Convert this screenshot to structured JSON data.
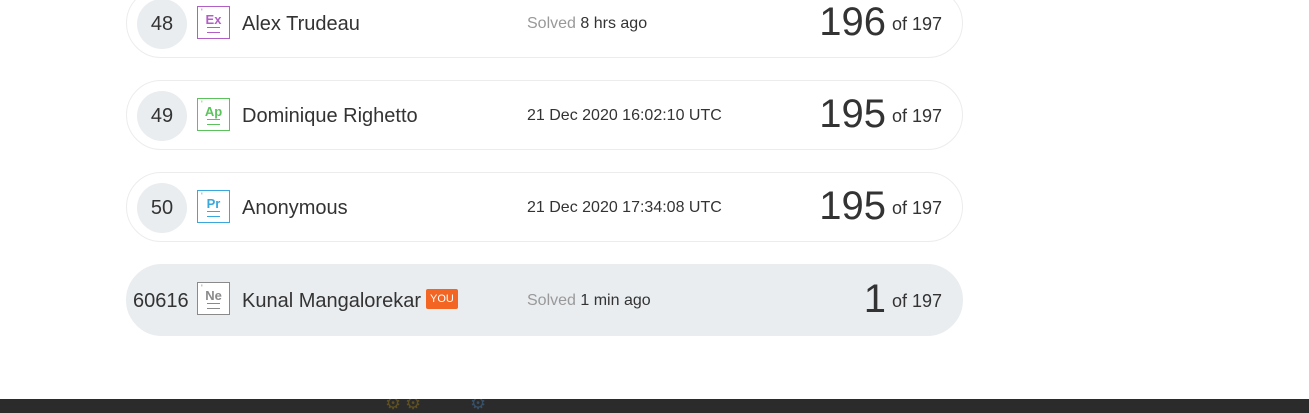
{
  "leaderboard": {
    "rows": [
      {
        "rank": "48",
        "element": "Ex",
        "color": "#b25fc5",
        "name": "Alex Trudeau",
        "time_prefix": "Solved",
        "time": "8 hrs ago",
        "score": "196",
        "of": "of 197"
      },
      {
        "rank": "49",
        "element": "Ap",
        "color": "#5cc35c",
        "name": "Dominique Righetto",
        "time_prefix": "",
        "time": "21 Dec 2020 16:02:10 UTC",
        "score": "195",
        "of": "of 197"
      },
      {
        "rank": "50",
        "element": "Pr",
        "color": "#3aa7dd",
        "name": "Anonymous",
        "time_prefix": "",
        "time": "21 Dec 2020 17:34:08 UTC",
        "score": "195",
        "of": "of 197"
      }
    ],
    "current_user": {
      "rank": "60616",
      "element": "Ne",
      "color": "#8a8a8a",
      "name": "Kunal Mangalorekar",
      "you_label": "YOU",
      "time_prefix": "Solved",
      "time": "1 min ago",
      "score": "1",
      "of": "of 197"
    }
  },
  "colors": {
    "you_badge": "#f26522",
    "highlight_row": "#e9edf0",
    "footer": "#2b2b2b"
  }
}
